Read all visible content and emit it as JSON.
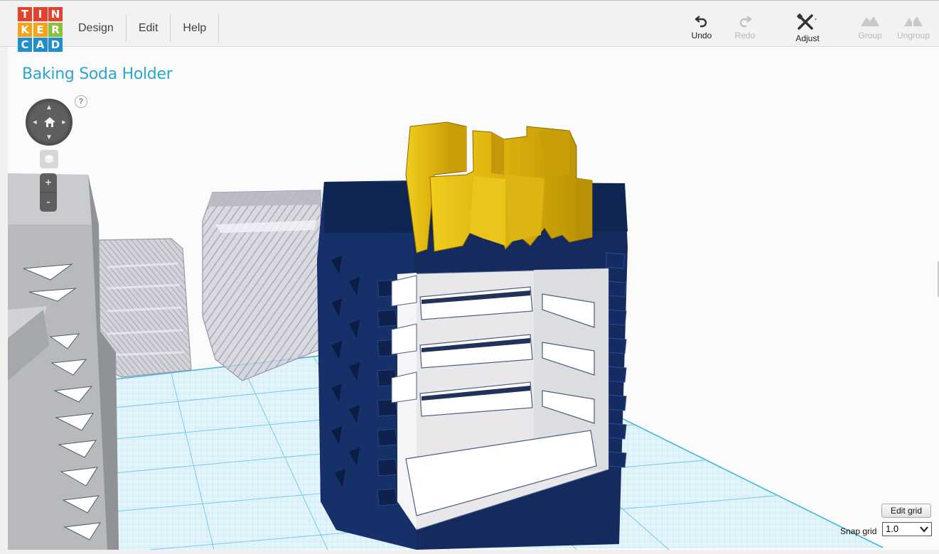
{
  "logo": {
    "letters": [
      "T",
      "I",
      "N",
      "K",
      "E",
      "R",
      "C",
      "A",
      "D"
    ]
  },
  "menu": {
    "items": [
      "Design",
      "Edit",
      "Help"
    ]
  },
  "toolbar": {
    "undo": "Undo",
    "redo": "Redo",
    "adjust": "Adjust",
    "group": "Group",
    "ungroup": "Ungroup"
  },
  "design": {
    "title": "Baking Soda Holder"
  },
  "nav": {
    "help": "?",
    "zoom_in": "+",
    "zoom_out": "-"
  },
  "grid": {
    "edit_label": "Edit grid",
    "snap_label": "Snap grid",
    "snap_value": "1.0"
  },
  "colors": {
    "accent": "#2aa7cf",
    "navy_object": "#13285a",
    "yellow_object": "#e7bf12",
    "grid_line": "#7fd1ea",
    "grid_fill": "#dff2fa"
  }
}
